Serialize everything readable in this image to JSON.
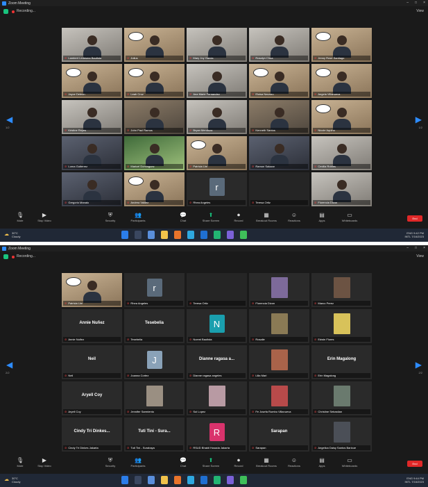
{
  "window_title": "Zoom Meeting",
  "window_controls": [
    "–",
    "□",
    "×"
  ],
  "recording_label": "Recording...",
  "view_label": "View",
  "nav": {
    "left_label": "1/2",
    "right_label": "1/2",
    "left_label_2": "2/2",
    "right_label_2": "2/2"
  },
  "toolbar": {
    "items": [
      {
        "icon": "microphone-icon",
        "label": "Mute"
      },
      {
        "icon": "video-camera-icon",
        "label": "Stop Video"
      },
      {
        "icon": "security-shield-icon",
        "label": "Security"
      },
      {
        "icon": "participants-icon",
        "label": "Participants"
      },
      {
        "icon": "chat-icon",
        "label": "Chat"
      },
      {
        "icon": "share-screen-icon",
        "label": "Share Screen"
      },
      {
        "icon": "record-icon",
        "label": "Record"
      },
      {
        "icon": "breakout-rooms-icon",
        "label": "Breakout Rooms"
      },
      {
        "icon": "reactions-icon",
        "label": "Reactions"
      },
      {
        "icon": "apps-icon",
        "label": "Apps"
      },
      {
        "icon": "whiteboard-icon",
        "label": "Whiteboards"
      }
    ],
    "end_label": "End"
  },
  "taskbar": {
    "weather_temp": "30°C",
    "weather_desc": "Cloudy",
    "lang": "ENG",
    "region": "INTL",
    "time": "9:42 PM",
    "date": "7/16/2023",
    "time_2": "9:44 PM",
    "date_2": "7/16/2023"
  },
  "screens": [
    {
      "tiles": [
        {
          "kind": "video",
          "style": "v4",
          "name": "Lambert Ledesma Bautista"
        },
        {
          "kind": "video",
          "style": "v2",
          "name": "Julius",
          "bubble": true
        },
        {
          "kind": "video",
          "style": "v4",
          "name": "Mary Joy Garcia"
        },
        {
          "kind": "video",
          "style": "v4",
          "name": "Rosalyn Chua"
        },
        {
          "kind": "video",
          "style": "v2",
          "name": "Jenny Rose Santiago",
          "bubble": true
        },
        {
          "kind": "video",
          "style": "v2",
          "name": "Jayce Deleon",
          "bubble": true
        },
        {
          "kind": "video",
          "style": "v2",
          "name": "Leah Cruz",
          "bubble": true
        },
        {
          "kind": "video",
          "style": "v4",
          "name": "Ana Marie Fernandez"
        },
        {
          "kind": "video",
          "style": "v2",
          "name": "Eloisa Navarro",
          "bubble": true
        },
        {
          "kind": "video",
          "style": "v2",
          "name": "Angela Villanueva",
          "bubble": true
        },
        {
          "kind": "video",
          "style": "v4",
          "name": "Kristine Reyes"
        },
        {
          "kind": "video",
          "style": "v1",
          "name": "John Paul Ramos"
        },
        {
          "kind": "video",
          "style": "v4",
          "name": "Bryan Mendoza"
        },
        {
          "kind": "video",
          "style": "v1",
          "name": "Kenneth Santos"
        },
        {
          "kind": "video",
          "style": "v2",
          "name": "Nicole Aquino",
          "bubble": true
        },
        {
          "kind": "video",
          "style": "v5",
          "name": "Lorna Gutierrez"
        },
        {
          "kind": "video",
          "style": "v3",
          "name": "Maricel Dominguez"
        },
        {
          "kind": "video",
          "style": "v2",
          "name": "Patricia Lim",
          "bubble": true
        },
        {
          "kind": "video",
          "style": "v5",
          "name": "Ramon Salazar"
        },
        {
          "kind": "video",
          "style": "v4",
          "name": "Cecilia Robles"
        },
        {
          "kind": "video",
          "style": "v5",
          "name": "Gregorio Manalo"
        },
        {
          "kind": "video",
          "style": "v2",
          "name": "Andrea Valdez",
          "bubble": true
        },
        {
          "kind": "avatar",
          "letter": "r",
          "color": "#5a6a7a",
          "name": "Rhea Angeles"
        },
        {
          "kind": "empty",
          "name": "Teresa Ortiz"
        },
        {
          "kind": "video",
          "style": "v4",
          "name": "Florencia Dizon"
        }
      ]
    },
    {
      "tiles": [
        {
          "kind": "video",
          "style": "v2",
          "name": "Patricia Lim",
          "bubble": true
        },
        {
          "kind": "avatar",
          "letter": "r",
          "color": "#5a6a7a",
          "name": "Rhea Angeles"
        },
        {
          "kind": "empty",
          "name": "Teresa Ortiz"
        },
        {
          "kind": "photo",
          "color": "#7d6a9a",
          "name": "Florencia Dizon"
        },
        {
          "kind": "photo",
          "color": "#6c5343",
          "name": "Marco Perez"
        },
        {
          "kind": "text",
          "big": "Annie Nuñez",
          "name": "Annie Nuñez"
        },
        {
          "kind": "text",
          "big": "Tesebelia",
          "name": "Tesebelia"
        },
        {
          "kind": "avatar",
          "letter": "N",
          "color": "#1a9fae",
          "name": "Noemi Bautista"
        },
        {
          "kind": "photo",
          "color": "#8a7a55",
          "name": "Rosalie"
        },
        {
          "kind": "photo",
          "color": "#d8c25a",
          "name": "Edwin Flores"
        },
        {
          "kind": "text",
          "big": "Neil",
          "name": "Neil"
        },
        {
          "kind": "avatar",
          "letter": "J",
          "color": "#8aa2b8",
          "name": "Joanna Cortez"
        },
        {
          "kind": "text",
          "big": "Dianne ragasa a...",
          "name": "Dianne ragasa angeles"
        },
        {
          "kind": "photo",
          "color": "#a9634a",
          "name": "Lilia Mari"
        },
        {
          "kind": "text",
          "big": "Erin Magalong",
          "name": "Erin Magalong"
        },
        {
          "kind": "text",
          "big": "Aryell Coy",
          "name": "Aryell Coy"
        },
        {
          "kind": "photo",
          "color": "#9a8f82",
          "name": "Jennifer Sarmiento"
        },
        {
          "kind": "photo",
          "color": "#b89aa3",
          "name": "Sol Lopez"
        },
        {
          "kind": "photo",
          "color": "#b84a4a",
          "name": "Fe Josefa Rumbo Villanueva"
        },
        {
          "kind": "photo",
          "color": "#6a7a6e",
          "name": "Christine Sebastian"
        },
        {
          "kind": "text",
          "big": "Cindy Tri Dinkes...",
          "name": "Cindy Tri Dinkes Jakarta"
        },
        {
          "kind": "text",
          "big": "Tuti Tini - Sura...",
          "name": "Tuti Tini - Surabaya"
        },
        {
          "kind": "avatar",
          "letter": "R",
          "color": "#d9336c",
          "name": "RSUD Bhakti Husada Jakarta"
        },
        {
          "kind": "text",
          "big": "Sarapan",
          "name": "Sarapan"
        },
        {
          "kind": "photo",
          "color": "#4b4f57",
          "name": "Angelica Daisy Santos Baricue"
        }
      ]
    }
  ]
}
